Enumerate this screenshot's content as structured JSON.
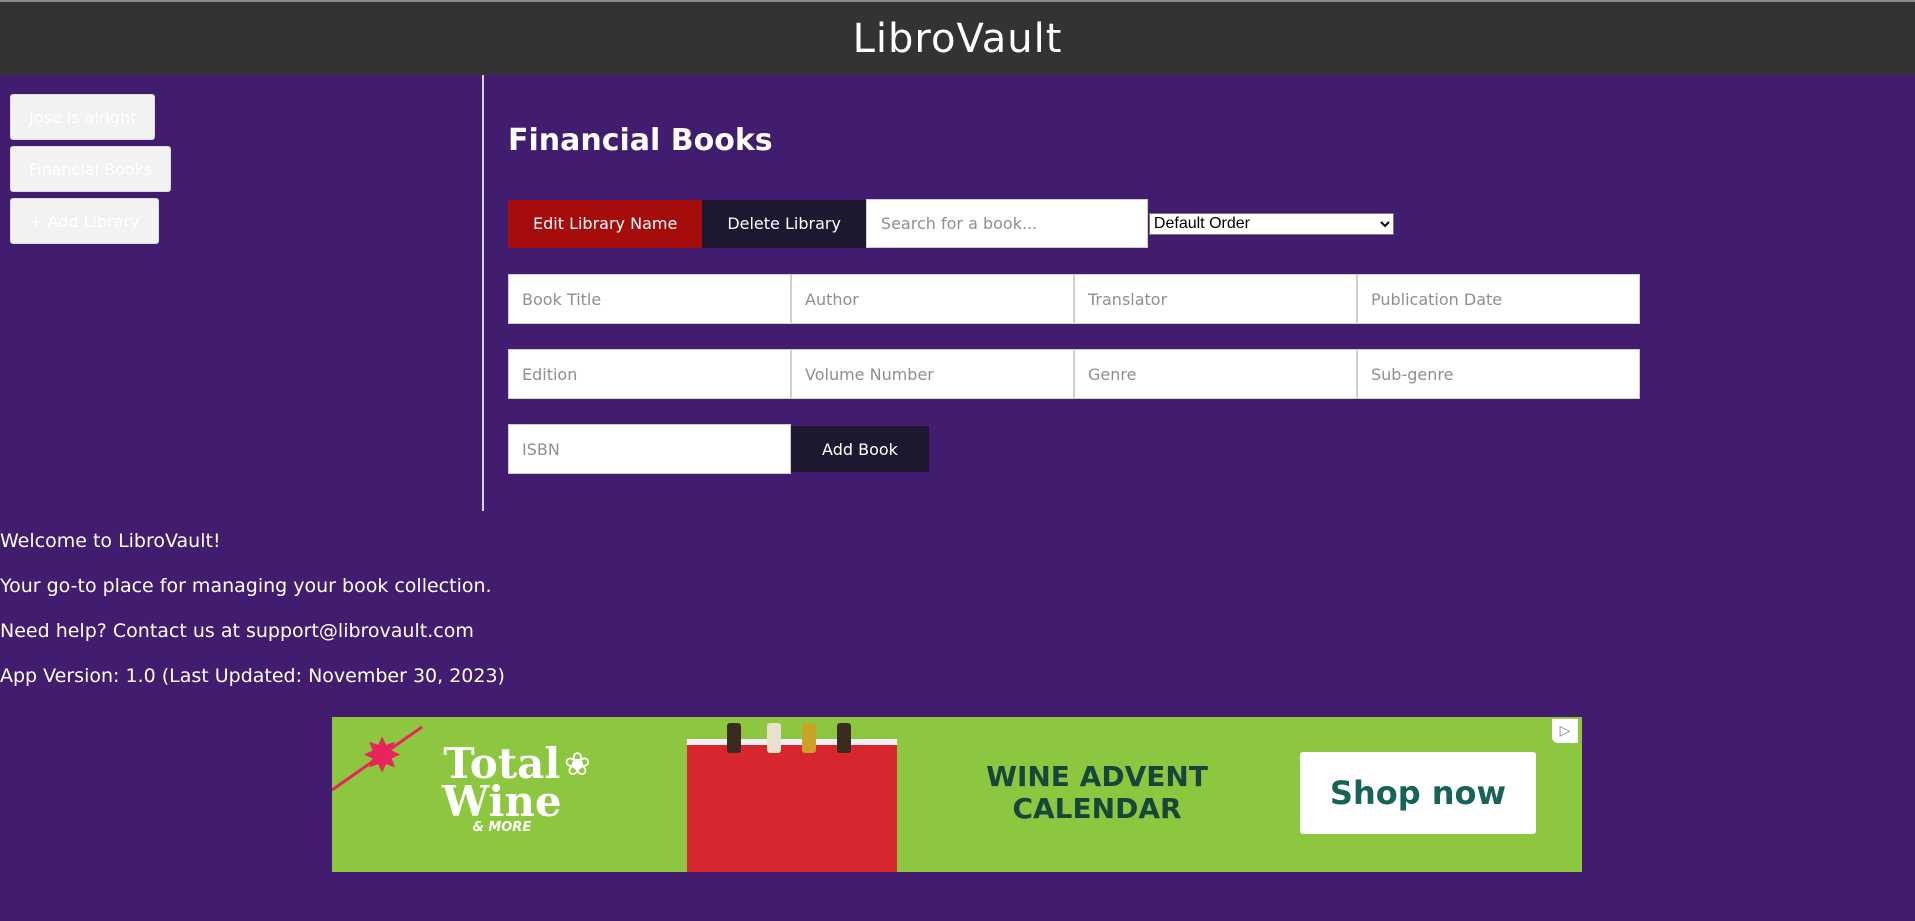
{
  "app": {
    "title": "LibroVault"
  },
  "sidebar": {
    "libraries": [
      {
        "label": "Jose is alright"
      },
      {
        "label": "Financial Books"
      }
    ],
    "add_label": "+ Add Library"
  },
  "main": {
    "library_title": "Financial Books",
    "toolbar": {
      "edit_label": "Edit Library Name",
      "delete_label": "Delete Library",
      "search_placeholder": "Search for a book...",
      "sort_selected": "Default Order"
    },
    "form": {
      "fields": [
        {
          "placeholder": "Book Title"
        },
        {
          "placeholder": "Author"
        },
        {
          "placeholder": "Translator"
        },
        {
          "placeholder": "Publication Date"
        },
        {
          "placeholder": "Edition"
        },
        {
          "placeholder": "Volume Number"
        },
        {
          "placeholder": "Genre"
        },
        {
          "placeholder": "Sub-genre"
        },
        {
          "placeholder": "ISBN"
        }
      ],
      "add_label": "Add Book"
    }
  },
  "footer": {
    "lines": [
      "Welcome to LibroVault!",
      "Your go-to place for managing your book collection.",
      "Need help? Contact us at support@librovault.com",
      "App Version: 1.0 (Last Updated: November 30, 2023)"
    ]
  },
  "ad": {
    "brand_line1": "Total",
    "brand_line2": "Wine",
    "brand_line3": "& MORE",
    "headline": "WINE ADVENT CALENDAR",
    "cta": "Shop now",
    "adchoices_icon": "adchoices-icon"
  },
  "colors": {
    "background": "#421c6e",
    "header": "#333333",
    "edit_button": "#a50d0d",
    "dark_button": "#1d1730",
    "ad_background": "#8dc63f"
  }
}
